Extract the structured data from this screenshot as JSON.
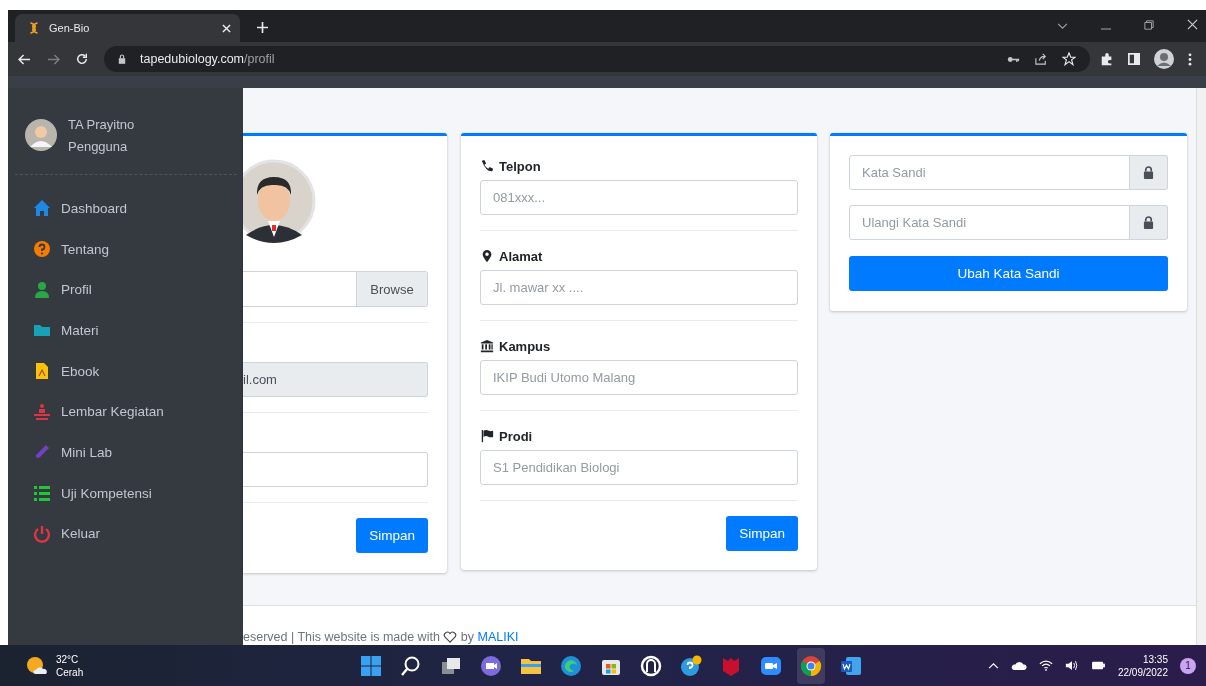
{
  "browser": {
    "tab_title": "Gen-Bio",
    "url_host": "tapedubiology.com",
    "url_path": "/profil"
  },
  "sidebar": {
    "user": {
      "name": "TA Prayitno",
      "role": "Pengguna"
    },
    "items": [
      {
        "label": "Dashboard",
        "kind": "home",
        "color": "#1e88e5"
      },
      {
        "label": "Tentang",
        "kind": "question",
        "color": "#f57c00"
      },
      {
        "label": "Profil",
        "kind": "user",
        "color": "#28a745"
      },
      {
        "label": "Materi",
        "kind": "folder",
        "color": "#17a2b8"
      },
      {
        "label": "Ebook",
        "kind": "file",
        "color": "#ffc107"
      },
      {
        "label": "Lembar Kegiatan",
        "kind": "activity",
        "color": "#dc3545"
      },
      {
        "label": "Mini Lab",
        "kind": "tube",
        "color": "#6f42c1"
      },
      {
        "label": "Uji Kompetensi",
        "kind": "list",
        "color": "#20c933"
      },
      {
        "label": "Keluar",
        "kind": "power",
        "color": "#dc3545"
      }
    ]
  },
  "profile_card": {
    "browse_button": "Browse",
    "email_value": "il.com",
    "save_button": "Simpan"
  },
  "contact_card": {
    "fields": [
      {
        "label": "Telpon",
        "kind": "phone",
        "placeholder": "081xxx..."
      },
      {
        "label": "Alamat",
        "kind": "pin",
        "placeholder": "Jl. mawar xx ...."
      },
      {
        "label": "Kampus",
        "kind": "bank",
        "placeholder": "IKIP Budi Utomo Malang"
      },
      {
        "label": "Prodi",
        "kind": "flag",
        "placeholder": "S1 Pendidikan Biologi"
      }
    ],
    "save_button": "Simpan"
  },
  "password_card": {
    "fields": [
      {
        "placeholder": "Kata Sandi"
      },
      {
        "placeholder": "Ulangi Kata Sandi"
      }
    ],
    "submit_button": "Ubah Kata Sandi"
  },
  "footer": {
    "text": "eserved | This website is made with",
    "by": "by",
    "link": "MALIKI"
  },
  "taskbar": {
    "weather": {
      "temperature": "32°C",
      "condition": "Cerah"
    },
    "apps": [
      {
        "kind": "windows",
        "selected": false
      },
      {
        "kind": "search",
        "selected": false
      },
      {
        "kind": "taskview",
        "selected": false
      },
      {
        "kind": "chat",
        "selected": false
      },
      {
        "kind": "files",
        "selected": false
      },
      {
        "kind": "edge",
        "selected": false
      },
      {
        "kind": "store",
        "selected": false
      },
      {
        "kind": "ring",
        "selected": false
      },
      {
        "kind": "help",
        "selected": false
      },
      {
        "kind": "shield",
        "selected": false
      },
      {
        "kind": "video",
        "selected": false
      },
      {
        "kind": "chrome",
        "selected": true
      },
      {
        "kind": "word",
        "selected": false
      }
    ],
    "time": "13:35",
    "date": "22/09/2022",
    "notifications": "1"
  }
}
